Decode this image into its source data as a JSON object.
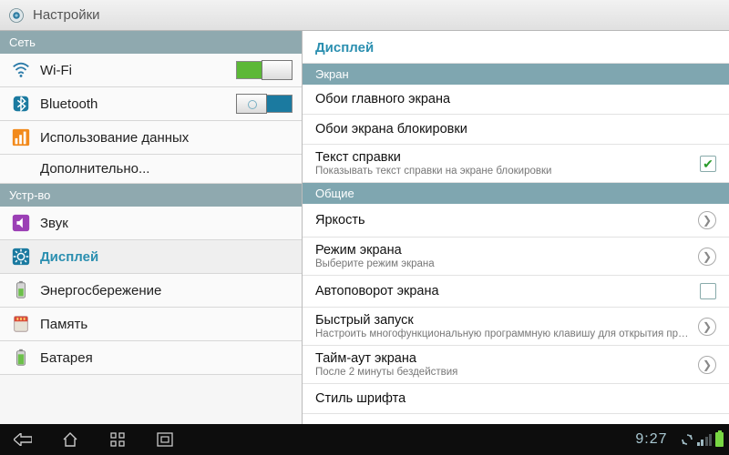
{
  "titlebar": {
    "title": "Настройки"
  },
  "sidebar": {
    "sections": [
      {
        "header": "Сеть",
        "items": [
          {
            "key": "wifi",
            "label": "Wi-Fi",
            "toggle": "on"
          },
          {
            "key": "bluetooth",
            "label": "Bluetooth",
            "toggle": "off"
          },
          {
            "key": "data-usage",
            "label": "Использование данных"
          },
          {
            "key": "more",
            "label": "Дополнительно...",
            "noicon": true
          }
        ]
      },
      {
        "header": "Устр-во",
        "items": [
          {
            "key": "sound",
            "label": "Звук"
          },
          {
            "key": "display",
            "label": "Дисплей",
            "selected": true
          },
          {
            "key": "power",
            "label": "Энергосбережение"
          },
          {
            "key": "storage",
            "label": "Память"
          },
          {
            "key": "battery",
            "label": "Батарея"
          }
        ]
      }
    ]
  },
  "content": {
    "title": "Дисплей",
    "groups": [
      {
        "header": "Экран",
        "rows": [
          {
            "key": "home-wallpaper",
            "title": "Обои главного экрана"
          },
          {
            "key": "lock-wallpaper",
            "title": "Обои экрана блокировки"
          },
          {
            "key": "help-text",
            "title": "Текст справки",
            "sub": "Показывать текст справки на экране блокировки",
            "checkbox": true,
            "checked": true
          }
        ]
      },
      {
        "header": "Общие",
        "rows": [
          {
            "key": "brightness",
            "title": "Яркость",
            "chevron": true
          },
          {
            "key": "screen-mode",
            "title": "Режим экрана",
            "sub": "Выберите режим экрана",
            "chevron": true
          },
          {
            "key": "auto-rotate",
            "title": "Автоповорот экрана",
            "checkbox": true,
            "checked": false
          },
          {
            "key": "quick-launch",
            "title": "Быстрый запуск",
            "sub": "Настроить многофункциональную программную клавишу для открытия приложений",
            "chevron": true
          },
          {
            "key": "screen-timeout",
            "title": "Тайм-аут экрана",
            "sub": "После 2 минуты бездействия",
            "chevron": true
          },
          {
            "key": "font-style",
            "title": "Стиль шрифта"
          }
        ]
      }
    ]
  },
  "navbar": {
    "clock": "9:27"
  }
}
